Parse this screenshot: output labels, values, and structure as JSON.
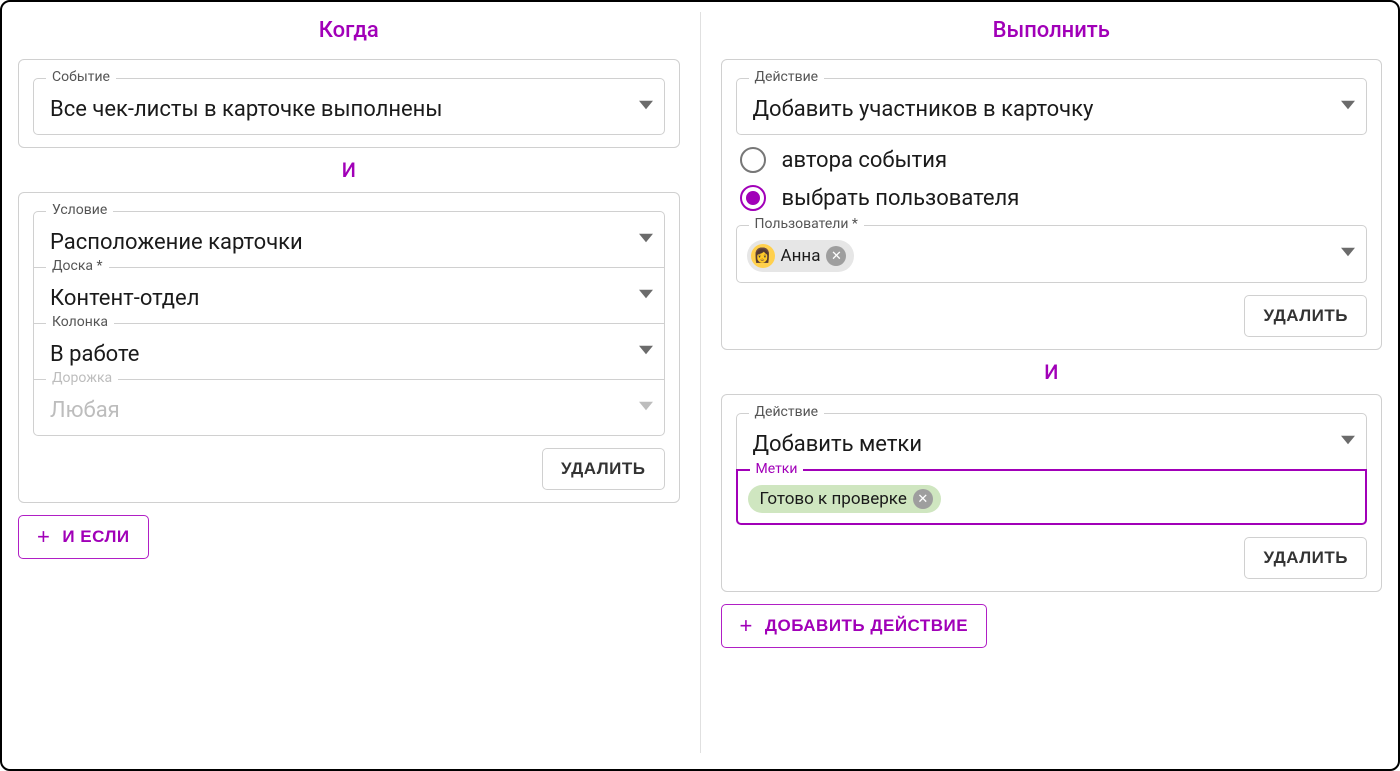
{
  "when": {
    "title": "Когда",
    "event_label": "Событие",
    "event_value": "Все чек-листы в карточке выполнены",
    "connector": "И",
    "condition_label": "Условие",
    "condition_value": "Расположение карточки",
    "board_label": "Доска *",
    "board_value": "Контент-отдел",
    "column_label": "Колонка",
    "column_value": "В работе",
    "lane_label": "Дорожка",
    "lane_placeholder": "Любая",
    "delete_btn": "УДАЛИТЬ",
    "add_if_btn": "И ЕСЛИ"
  },
  "run": {
    "title": "Выполнить",
    "action1_label": "Действие",
    "action1_value": "Добавить участников в карточку",
    "radio1": "автора события",
    "radio2": "выбрать пользователя",
    "radio_selected": 2,
    "users_label": "Пользователи *",
    "user_chip": "Анна",
    "delete_btn": "УДАЛИТЬ",
    "connector": "И",
    "action2_label": "Действие",
    "action2_value": "Добавить метки",
    "labels_label": "Метки",
    "label_chip": "Готово к проверке",
    "add_action_btn": "ДОБАВИТЬ ДЕЙСТВИЕ"
  },
  "ui": {
    "plus": "+"
  }
}
